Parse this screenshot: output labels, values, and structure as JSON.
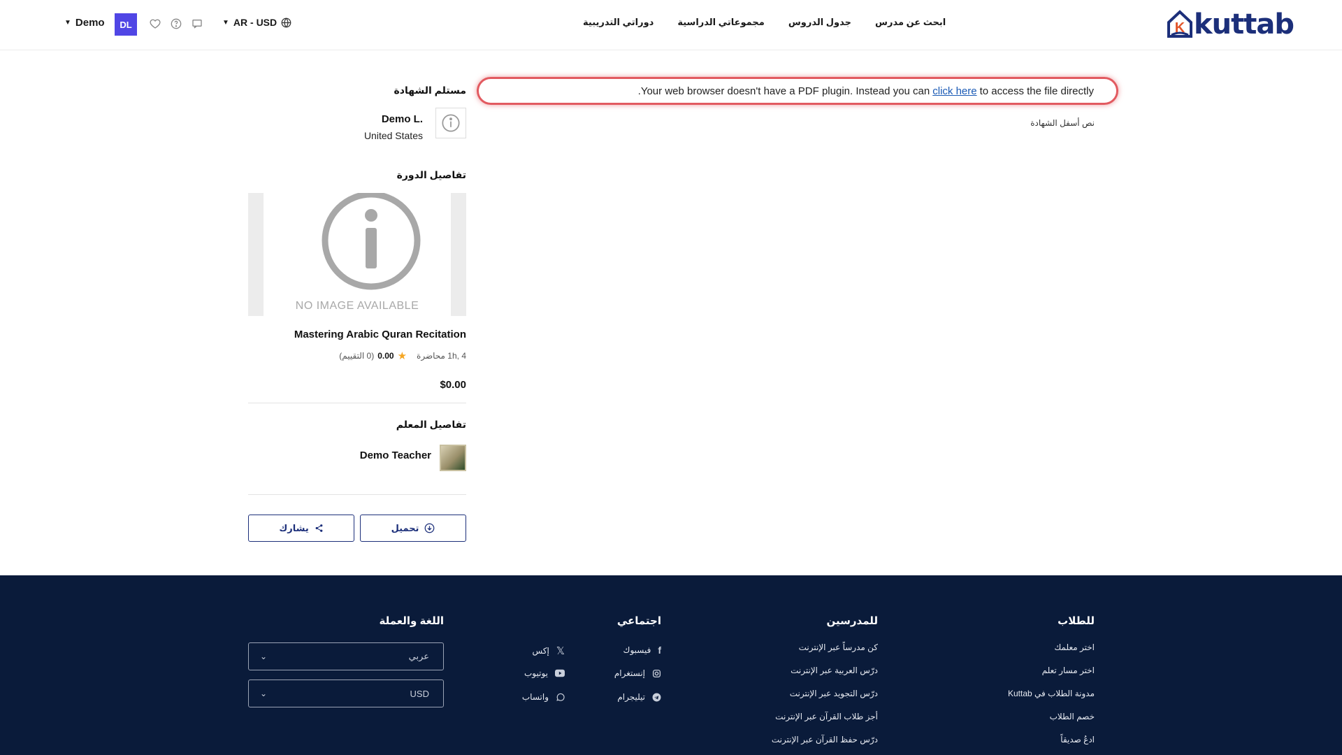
{
  "header": {
    "user_name": "Demo",
    "avatar_initials": "DL",
    "locale": "AR - USD",
    "nav": [
      "ابحث عن مدرس",
      "جدول الدروس",
      "مجموعاتي الدراسية",
      "دوراتي التدريبية"
    ],
    "logo_text": "kuttab"
  },
  "pdf_notice": {
    "before": ".Your web browser doesn't have a PDF plugin. Instead you can",
    "link": "click here",
    "after": "to access the file directly"
  },
  "certificate_footer_text": "نص أسفل الشهادة",
  "recipient": {
    "title": "مستلم الشهادة",
    "name": "Demo L.",
    "country": "United States"
  },
  "course": {
    "title_section": "تفاصيل الدورة",
    "no_image": "NO IMAGE AVAILABLE",
    "name": "Mastering Arabic Quran Recitation",
    "duration": "1h, 4 محاضرة",
    "rating": "0.00",
    "rating_count": "(0 التقييم)",
    "price": "$0.00"
  },
  "teacher": {
    "title_section": "تفاصيل المعلم",
    "name": "Demo Teacher"
  },
  "buttons": {
    "download": "تحميل",
    "share": "يشارك"
  },
  "footer": {
    "students": {
      "title": "للطلاب",
      "links": [
        "اختر معلمك",
        "اختر مسار تعلم",
        "مدونة الطلاب في Kuttab",
        "خصم الطلاب",
        "ادعُ صديقاً"
      ]
    },
    "teachers": {
      "title": "للمدرسين",
      "links": [
        "كن مدرساً عبر الإنترنت",
        "درّس العربية عبر الإنترنت",
        "درّس التجويد عبر الإنترنت",
        "أجز طلاب القرآن عبر الإنترنت",
        "درّس حفظ القرآن عبر الإنترنت"
      ]
    },
    "social": {
      "title": "اجتماعي",
      "facebook": "فيسبوك",
      "x": "إكس",
      "instagram": "إنستغرام",
      "youtube": "يوتيوب",
      "telegram": "تيليجرام",
      "whatsapp": "واتساب"
    },
    "language": {
      "title": "اللغة والعملة",
      "language_value": "عربي",
      "currency_value": "USD"
    }
  },
  "colors": {
    "brand": "#1c2f7a",
    "avatar": "#5046e5",
    "footer_bg": "#0a1b3a",
    "notice_border": "#e25a60",
    "star": "#f5a623"
  }
}
